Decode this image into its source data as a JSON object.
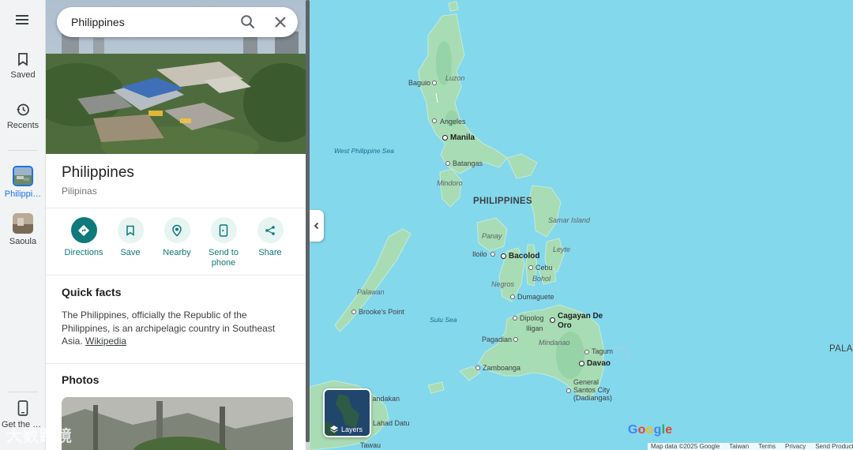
{
  "rail": {
    "menu_icon": "hamburger-menu-icon",
    "saved_label": "Saved",
    "recents_label": "Recents",
    "philippines_label": "Philippi…",
    "saoula_label": "Saoula",
    "get_app_label": "Get the app"
  },
  "search": {
    "value": "Philippines"
  },
  "place": {
    "title": "Philippines",
    "subtitle": "Pilipinas"
  },
  "actions": [
    {
      "label": "Directions",
      "icon": "directions-icon"
    },
    {
      "label": "Save",
      "icon": "bookmark-icon"
    },
    {
      "label": "Nearby",
      "icon": "nearby-icon"
    },
    {
      "label": "Send to phone",
      "icon": "send-to-phone-icon"
    },
    {
      "label": "Share",
      "icon": "share-icon"
    }
  ],
  "quick_facts": {
    "title": "Quick facts",
    "text": "The Philippines, officially the Republic of the Philippines, is an archipelagic country in Southeast Asia.",
    "link": "Wikipedia"
  },
  "photos": {
    "title": "Photos"
  },
  "map": {
    "country_label": "PHILIPPINES",
    "palau_label": "PALA",
    "places": [
      {
        "name": "Baguio"
      },
      {
        "name": "Luzon"
      },
      {
        "name": "Angeles"
      },
      {
        "name": "Manila"
      },
      {
        "name": "Batangas"
      },
      {
        "name": "Mindoro"
      },
      {
        "name": "Samar Island"
      },
      {
        "name": "Panay"
      },
      {
        "name": "Leyte"
      },
      {
        "name": "Iloilo"
      },
      {
        "name": "Bacolod"
      },
      {
        "name": "Cebu"
      },
      {
        "name": "Bohol"
      },
      {
        "name": "Negros"
      },
      {
        "name": "Dumaguete"
      },
      {
        "name": "Palawan"
      },
      {
        "name": "Brooke's Point"
      },
      {
        "name": "Dipolog"
      },
      {
        "name": "Iligan"
      },
      {
        "name": "Cagayan De Oro"
      },
      {
        "name": "Mindanao"
      },
      {
        "name": "Pagadian"
      },
      {
        "name": "Tagum"
      },
      {
        "name": "Davao"
      },
      {
        "name": "Zamboanga"
      },
      {
        "name": "General Santos City (Dadiangas)"
      },
      {
        "name": "Sandakan"
      },
      {
        "name": "Lahad Datu"
      },
      {
        "name": "Tawau"
      }
    ],
    "seas": [
      {
        "name": "West Philippine Sea"
      },
      {
        "name": "Sulu Sea"
      }
    ],
    "layers_label": "Layers",
    "google_logo": "Google",
    "attribution": {
      "data": "Map data ©2025 Google",
      "region": "Taiwan",
      "terms": "Terms",
      "privacy": "Privacy",
      "feedback": "Send Product Feedback"
    }
  },
  "watermark": "大数跨境",
  "colors": {
    "accent": "#0e7a7a",
    "water": "#84d8ec",
    "land": "#a8dcb4",
    "land_dark": "#8fce9f",
    "selection": "#1a73e8"
  }
}
